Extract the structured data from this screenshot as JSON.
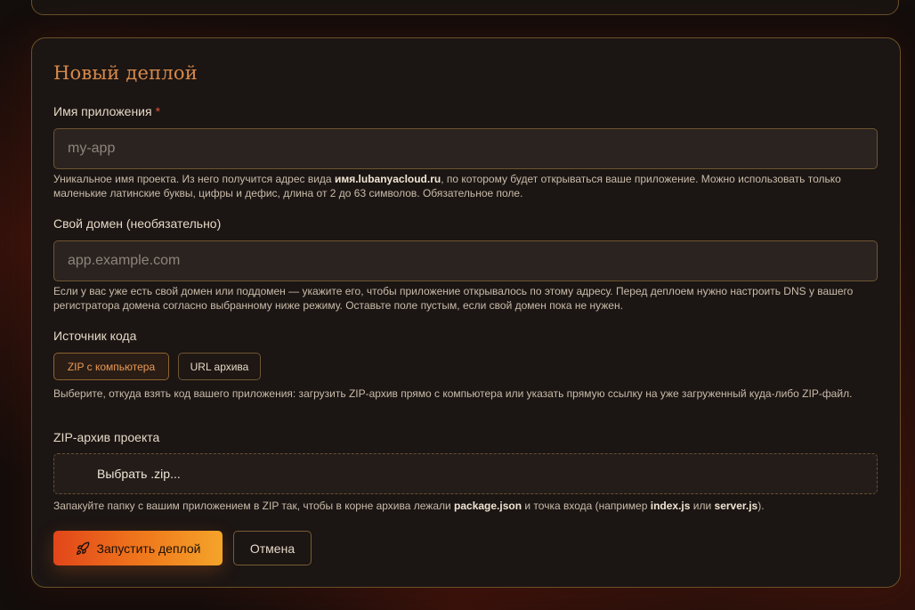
{
  "form": {
    "title": "Новый деплой",
    "app_name": {
      "label": "Имя приложения",
      "required_mark": "*",
      "placeholder": "my-app",
      "value": "",
      "hint_before": "Уникальное имя проекта. Из него получится адрес вида ",
      "hint_bold": "имя.lubanyacloud.ru",
      "hint_after": ", по которому будет открываться ваше приложение. Можно использовать только маленькие латинские буквы, цифры и дефис, длина от 2 до 63 символов. Обязательное поле."
    },
    "domain": {
      "label": "Свой домен (необязательно)",
      "placeholder": "app.example.com",
      "value": "",
      "hint": "Если у вас уже есть свой домен или поддомен — укажите его, чтобы приложение открывалось по этому адресу. Перед деплоем нужно настроить DNS у вашего регистратора домена согласно выбранному ниже режиму. Оставьте поле пустым, если свой домен пока не нужен."
    },
    "source": {
      "label": "Источник кода",
      "options": [
        "ZIP с компьютера",
        "URL архива"
      ],
      "selected": "ZIP с компьютера",
      "hint": "Выберите, откуда взять код вашего приложения: загрузить ZIP-архив прямо с компьютера или указать прямую ссылку на уже загруженный куда-либо ZIP-файл."
    },
    "zip": {
      "label": "ZIP-архив проекта",
      "button": "Выбрать .zip...",
      "hint_1": "Запакуйте папку с вашим приложением в ZIP так, чтобы в корне архива лежали ",
      "hint_bold_1": "package.json",
      "hint_2": " и точка входа (например ",
      "hint_bold_2": "index.js",
      "hint_3": " или ",
      "hint_bold_3": "server.js",
      "hint_4": ")."
    },
    "actions": {
      "deploy": "Запустить деплой",
      "cancel": "Отмена"
    }
  },
  "icons": {
    "deploy": "rocket-icon"
  },
  "colors": {
    "accent": "#e89a55",
    "title": "#d8894a",
    "required": "#e0503a",
    "border": "#6e5530",
    "button_gradient_start": "#e2461a",
    "button_gradient_end": "#f4a42a"
  }
}
